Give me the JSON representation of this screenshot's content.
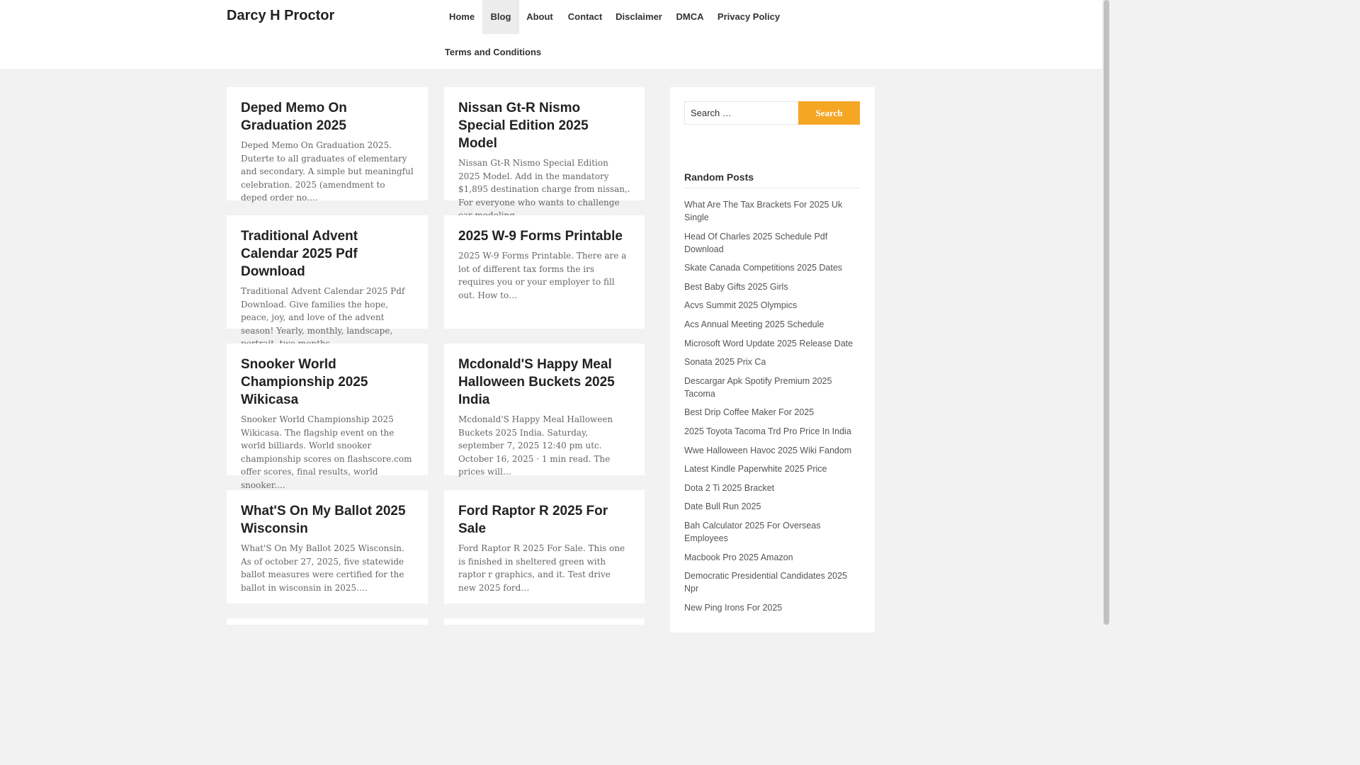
{
  "site": {
    "title": "Darcy H Proctor"
  },
  "nav": [
    {
      "label": "Home",
      "active": false
    },
    {
      "label": "Blog",
      "active": true
    },
    {
      "label": "About",
      "active": false
    },
    {
      "label": "Contact",
      "active": false
    },
    {
      "label": "Disclaimer",
      "active": false
    },
    {
      "label": "DMCA",
      "active": false
    },
    {
      "label": "Privacy Policy",
      "active": false
    },
    {
      "label": "Terms and Conditions",
      "active": false
    }
  ],
  "posts": [
    {
      "title": "Deped Memo On Graduation 2025",
      "excerpt": "Deped Memo On Graduation 2025. Duterte to all graduates of elementary and secondary. A simple but meaningful celebration. 2025 (amendment to deped order no.…"
    },
    {
      "title": "Nissan Gt-R Nismo Special Edition 2025 Model",
      "excerpt": "Nissan Gt-R Nismo Special Edition 2025 Model. Add in the mandatory $1,895 destination charge from nissan,. For everyone who wants to challenge car modeling.…"
    },
    {
      "title": "Traditional Advent Calendar 2025 Pdf Download",
      "excerpt": "Traditional Advent Calendar 2025 Pdf Download. Give families the hope, peace, joy, and love of the advent season! Yearly, monthly, landscape, portrait, two months…"
    },
    {
      "title": "2025 W-9 Forms Printable",
      "excerpt": "2025 W-9 Forms Printable. There are a lot of different tax forms the irs requires you or your employer to fill out. How to…"
    },
    {
      "title": "Snooker World Championship 2025 Wikicasa",
      "excerpt": "Snooker World Championship 2025 Wikicasa. The flagship event on the world billiards. World snooker championship scores on flashscore.com offer scores, final results, world snooker.…"
    },
    {
      "title": "Mcdonald'S Happy Meal Halloween Buckets 2025 India",
      "excerpt": "Mcdonald'S Happy Meal Halloween Buckets 2025 India. Saturday, september 7, 2025 12:40 pm utc. October 16, 2025 · 1 min read. The prices will…"
    },
    {
      "title": "What'S On My Ballot 2025 Wisconsin",
      "excerpt": "What'S On My Ballot 2025 Wisconsin. As of october 27, 2025, five statewide ballot measures were certified for the ballot in wisconsin in 2025.…"
    },
    {
      "title": "Ford Raptor R 2025 For Sale",
      "excerpt": "Ford Raptor R 2025 For Sale. This one is finished in sheltered green with raptor r graphics, and it. Test drive new 2025 ford…"
    }
  ],
  "search": {
    "placeholder": "Search …",
    "button_label": "Search"
  },
  "sidebar": {
    "widget_title": "Random Posts",
    "items": [
      "What Are The Tax Brackets For 2025 Uk Single",
      "Head Of Charles 2025 Schedule Pdf Download",
      "Skate Canada Competitions 2025 Dates",
      "Best Baby Gifts 2025 Girls",
      "Acvs Summit 2025 Olympics",
      "Acs Annual Meeting 2025 Schedule",
      "Microsoft Word Update 2025 Release Date",
      "Sonata 2025 Prix Ca",
      "Descargar Apk Spotify Premium 2025 Tacoma",
      "Best Drip Coffee Maker For 2025",
      "2025 Toyota Tacoma Trd Pro Price In India",
      "Wwe Halloween Havoc 2025 Wiki Fandom",
      "Latest Kindle Paperwhite 2025 Price",
      "Dota 2 Ti 2025 Bracket",
      "Date Bull Run 2025",
      "Bah Calculator 2025 For Overseas Employees",
      "Macbook Pro 2025 Amazon",
      "Democratic Presidential Candidates 2025 Npr",
      "New Ping Irons For 2025"
    ]
  },
  "colors": {
    "accent": "#f5a623",
    "page_bg": "#f2f2f2",
    "card_bg": "#ffffff"
  }
}
